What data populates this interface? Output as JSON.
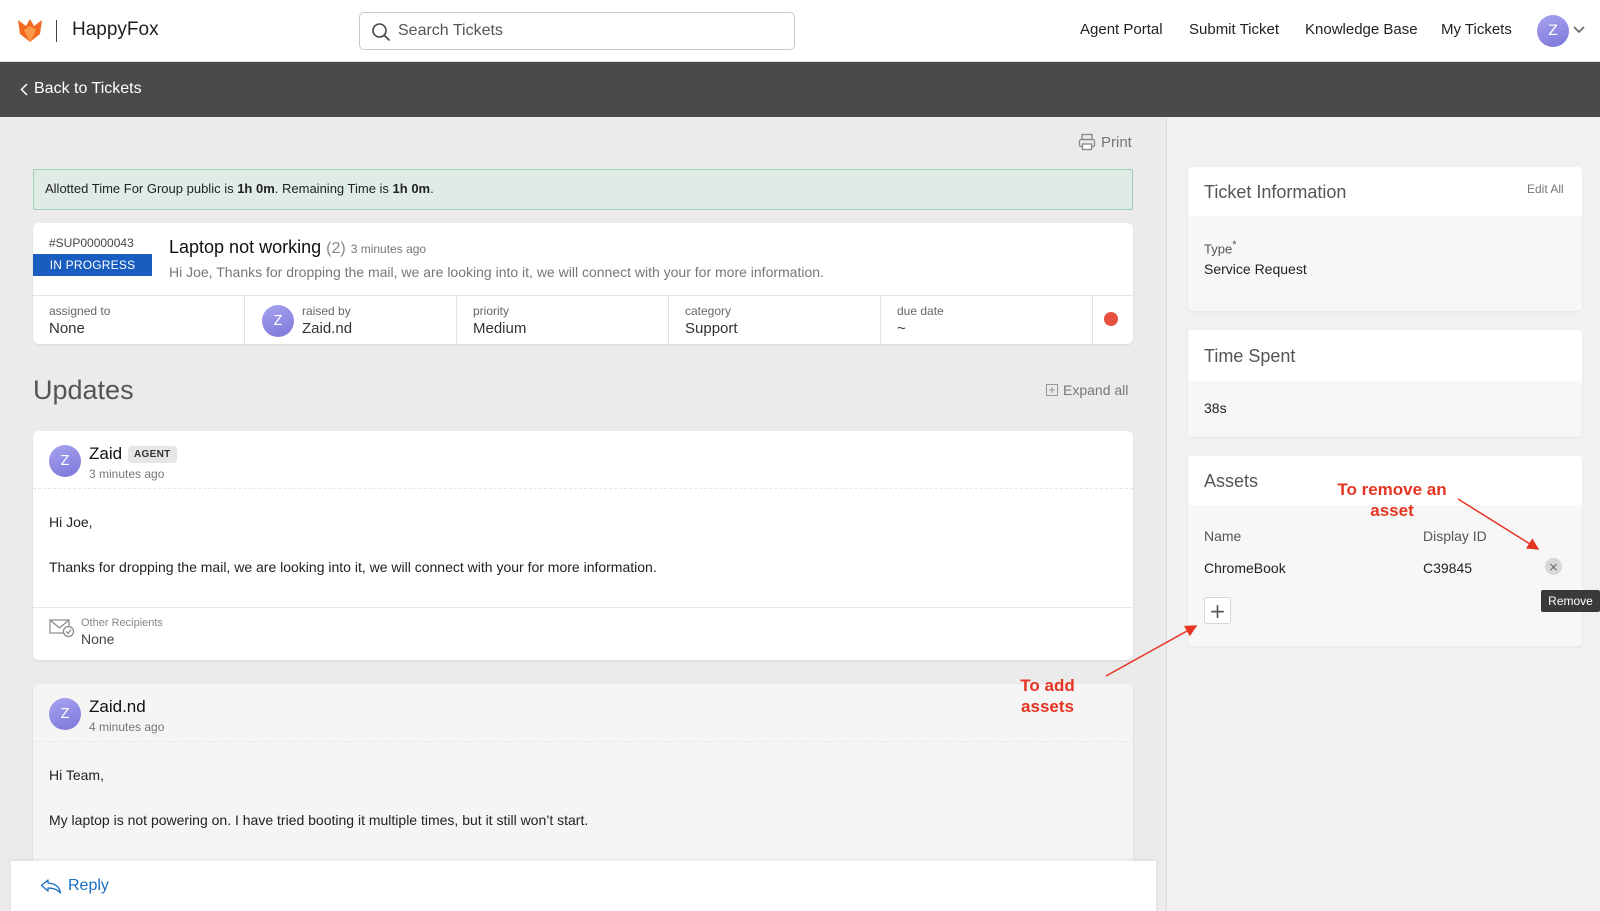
{
  "header": {
    "brand": "HappyFox",
    "search": {
      "placeholder": "Search Tickets"
    },
    "nav": [
      "Agent Portal",
      "Submit Ticket",
      "Knowledge Base",
      "My Tickets"
    ],
    "avatar_initial": "Z"
  },
  "subheader": {
    "back_label": "Back to Tickets"
  },
  "print_label": "Print",
  "alert": {
    "prefix": "Allotted Time For Group public is ",
    "allotted": "1h 0m",
    "middle": ". Remaining Time is ",
    "remaining": "1h 0m",
    "suffix": "."
  },
  "ticket": {
    "id": "#SUP00000043",
    "status": "IN PROGRESS",
    "title": "Laptop not working",
    "count": "(2)",
    "time": "3 minutes ago",
    "summary": "Hi Joe, Thanks for dropping the mail, we are looking into it, we will connect with your for more information.",
    "meta": {
      "assigned_label": "assigned to",
      "assigned_value": "None",
      "raised_label": "raised by",
      "raised_value": "Zaid.nd",
      "raised_initial": "Z",
      "priority_label": "priority",
      "priority_value": "Medium",
      "category_label": "category",
      "category_value": "Support",
      "due_label": "due date",
      "due_value": "~"
    },
    "status_dot_color": "#e7503f"
  },
  "updates": {
    "title": "Updates",
    "expand_label": "Expand all",
    "items": [
      {
        "initial": "Z",
        "name": "Zaid",
        "badge": "AGENT",
        "time": "3 minutes ago",
        "line1": "Hi Joe,",
        "line2": "Thanks for dropping the mail, we are looking into it, we will connect with your for more information.",
        "recipients_label": "Other Recipients",
        "recipients_value": "None"
      },
      {
        "initial": "Z",
        "name": "Zaid.nd",
        "time": "4 minutes ago",
        "line1": "Hi Team,",
        "line2": "My laptop is not powering on. I have tried booting it multiple times, but it still won’t start."
      }
    ]
  },
  "reply_label": "Reply",
  "sidebar": {
    "ticket_info": {
      "title": "Ticket Information",
      "edit_label": "Edit All",
      "type_label": "Type",
      "type_required": "*",
      "type_value": "Service Request"
    },
    "time_spent": {
      "title": "Time Spent",
      "value": "38s"
    },
    "assets": {
      "title": "Assets",
      "col_name": "Name",
      "col_display_id": "Display ID",
      "rows": [
        {
          "name": "ChromeBook",
          "display_id": "C39845"
        }
      ],
      "remove_tooltip": "Remove"
    }
  },
  "annotations": {
    "remove_line1": "To remove an",
    "remove_line2": "asset",
    "add_line1": "To add",
    "add_line2": "assets",
    "color": "#e53522"
  },
  "colors": {
    "status_blue": "#1a5dc1",
    "link_blue": "#1a6ec0",
    "brand_orange": "#f26b21"
  }
}
